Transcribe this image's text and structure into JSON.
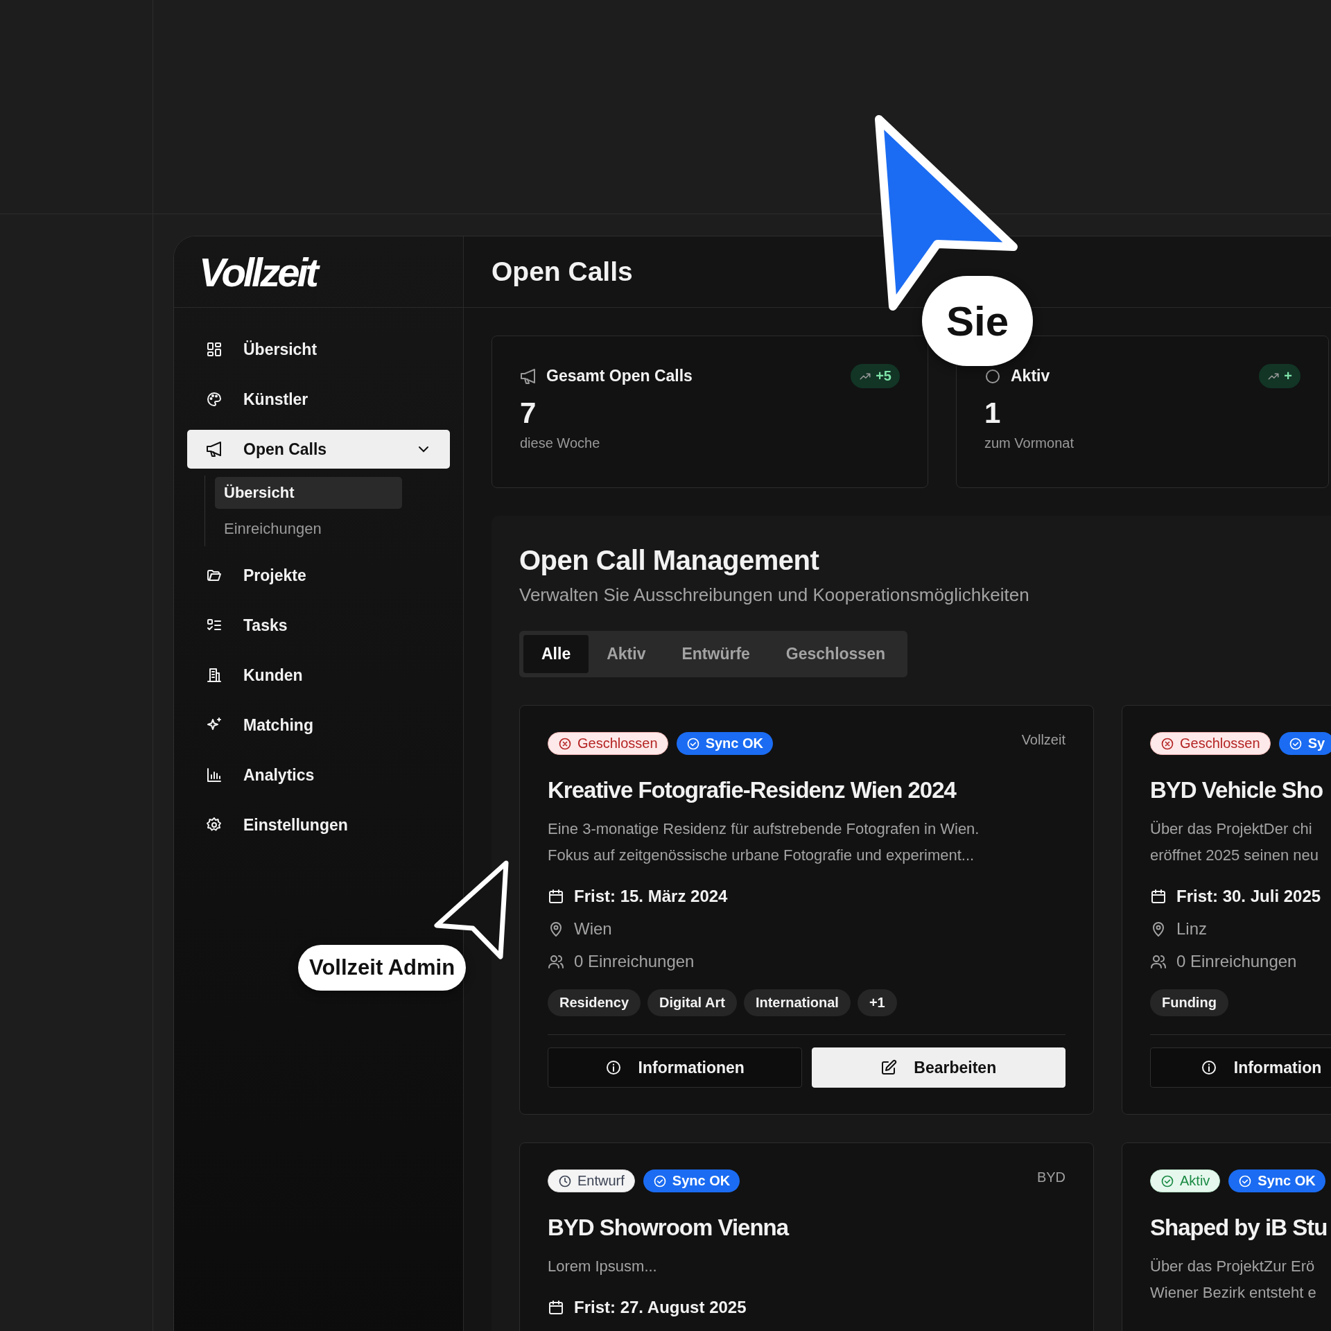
{
  "brand": "Vollzeit",
  "page_title": "Open Calls",
  "nav": [
    {
      "label": "Übersicht",
      "selected": false
    },
    {
      "label": "Künstler",
      "selected": false
    },
    {
      "label": "Open Calls",
      "selected": true,
      "expanded": true,
      "children": [
        {
          "label": "Übersicht",
          "selected": true
        },
        {
          "label": "Einreichungen",
          "selected": false
        }
      ]
    },
    {
      "label": "Projekte",
      "selected": false
    },
    {
      "label": "Tasks",
      "selected": false
    },
    {
      "label": "Kunden",
      "selected": false
    },
    {
      "label": "Matching",
      "selected": false
    },
    {
      "label": "Analytics",
      "selected": false
    },
    {
      "label": "Einstellungen",
      "selected": false
    }
  ],
  "stats": [
    {
      "title": "Gesamt Open Calls",
      "trend": "+5",
      "value": "7",
      "caption": "diese Woche"
    },
    {
      "title": "Aktiv",
      "trend": "+",
      "value": "1",
      "caption": "zum Vormonat"
    }
  ],
  "section": {
    "title": "Open Call Management",
    "subtitle": "Verwalten Sie Ausschreibungen und Kooperationsmöglichkeiten"
  },
  "tabs": [
    {
      "label": "Alle",
      "selected": true
    },
    {
      "label": "Aktiv",
      "selected": false
    },
    {
      "label": "Entwürfe",
      "selected": false
    },
    {
      "label": "Geschlossen",
      "selected": false
    }
  ],
  "cards": [
    {
      "status": {
        "kind": "closed",
        "label": "Geschlossen"
      },
      "sync": "Sync OK",
      "source": "Vollzeit",
      "title": "Kreative Fotografie-Residenz Wien 2024",
      "description_lines": [
        "Eine 3-monatige Residenz für aufstrebende Fotografen in Wien.",
        "Fokus auf zeitgenössische urbane Fotografie und experiment..."
      ],
      "deadline": "Frist: 15. März 2024",
      "location": "Wien",
      "submissions": "0 Einreichungen",
      "tags": [
        "Residency",
        "Digital Art",
        "International",
        "+1"
      ],
      "actions": [
        {
          "kind": "info",
          "label": "Informationen"
        },
        {
          "kind": "edit",
          "label": "Bearbeiten"
        }
      ]
    },
    {
      "status": {
        "kind": "closed",
        "label": "Geschlossen"
      },
      "sync": "Sy",
      "title": "BYD Vehicle Sho",
      "description_lines": [
        "Über das ProjektDer chi",
        "eröffnet 2025 seinen neu"
      ],
      "deadline": "Frist: 30. Juli 2025",
      "location": "Linz",
      "submissions": "0 Einreichungen",
      "tags": [
        "Funding"
      ],
      "actions": [
        {
          "kind": "info",
          "label": "Information"
        }
      ]
    },
    {
      "status": {
        "kind": "draft",
        "label": "Entwurf"
      },
      "sync": "Sync OK",
      "source": "BYD",
      "title": "BYD Showroom Vienna",
      "description_lines": [
        "Lorem Ipsusm..."
      ],
      "deadline": "Frist: 27. August 2025"
    },
    {
      "status": {
        "kind": "active",
        "label": "Aktiv"
      },
      "sync": "Sync OK",
      "title": "Shaped by iB Stu",
      "description_lines": [
        "Über das ProjektZur Erö",
        "Wiener Bezirk entsteht e"
      ]
    }
  ],
  "cursors": [
    {
      "kind": "filled",
      "label": "Sie"
    },
    {
      "kind": "outline",
      "label": "Vollzeit Admin"
    }
  ]
}
